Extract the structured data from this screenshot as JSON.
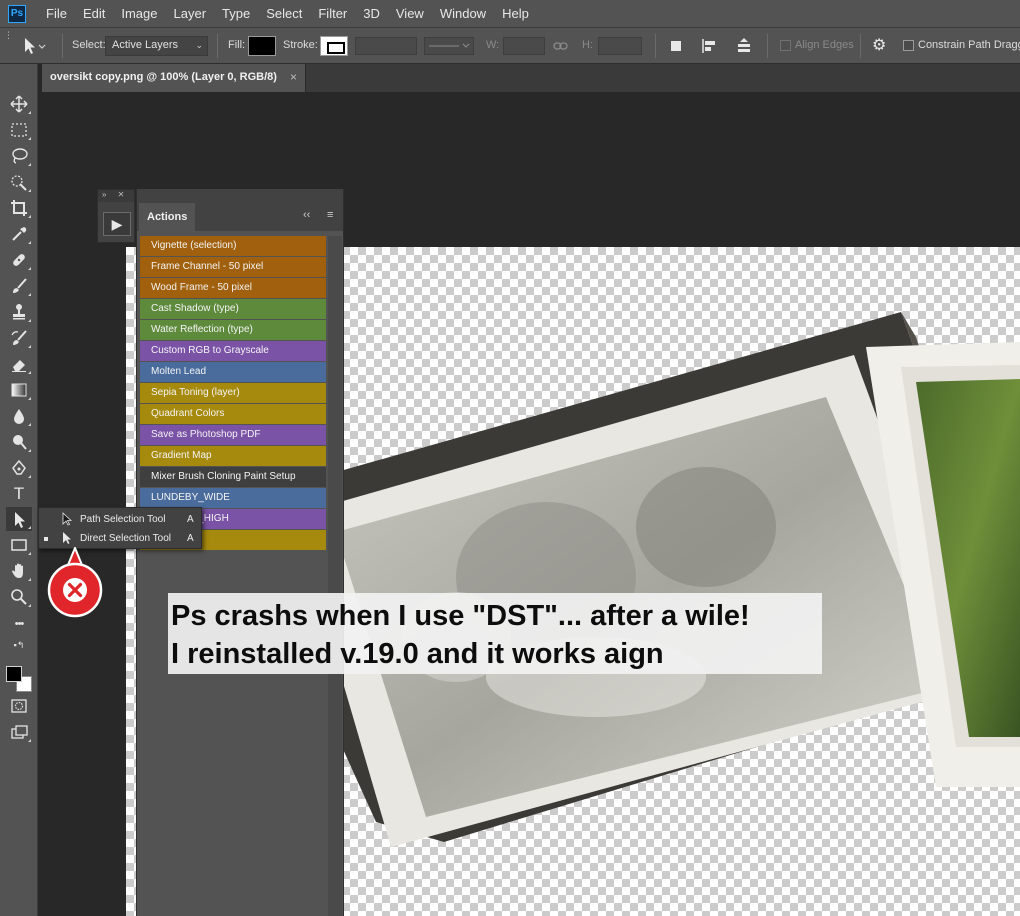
{
  "app": {
    "logo_text": "Ps",
    "menu": [
      "File",
      "Edit",
      "Image",
      "Layer",
      "Type",
      "Select",
      "Filter",
      "3D",
      "View",
      "Window",
      "Help"
    ]
  },
  "options_bar": {
    "select_label": "Select:",
    "select_value": "Active Layers",
    "fill_label": "Fill:",
    "stroke_label": "Stroke:",
    "w_label": "W:",
    "h_label": "H:",
    "align_edges_label": "Align Edges",
    "constrain_label": "Constrain Path Dragging"
  },
  "document": {
    "tab_title": "oversikt copy.png @ 100% (Layer 0, RGB/8)",
    "tab_close": "×"
  },
  "actions_panel": {
    "tab_label": "Actions",
    "collapse_glyph": "‹‹",
    "menu_glyph": "≡",
    "play_glyph": "▶",
    "items": [
      {
        "label": "Vignette (selection)",
        "color": "#a0600d"
      },
      {
        "label": "Frame Channel - 50 pixel",
        "color": "#a0600d"
      },
      {
        "label": "Wood Frame - 50 pixel",
        "color": "#a0600d"
      },
      {
        "label": "Cast Shadow (type)",
        "color": "#5e8a3c"
      },
      {
        "label": "Water Reflection (type)",
        "color": "#5e8a3c"
      },
      {
        "label": "Custom RGB to Grayscale",
        "color": "#7a52a6"
      },
      {
        "label": "Molten Lead",
        "color": "#4a6c9c"
      },
      {
        "label": "Sepia Toning (layer)",
        "color": "#a68a0e"
      },
      {
        "label": "Quadrant Colors",
        "color": "#a68a0e"
      },
      {
        "label": "Save as Photoshop PDF",
        "color": "#7a52a6"
      },
      {
        "label": "Gradient Map",
        "color": "#a68a0e"
      },
      {
        "label": "Mixer Brush Cloning Paint Setup",
        "color": "#3f3f3f"
      },
      {
        "label": "LUNDEBY_WIDE",
        "color": "#4a6c9c"
      },
      {
        "label": "LUNDEBY_HIGH",
        "color": "#7a52a6"
      },
      {
        "label": "",
        "color": "#a68a0e"
      }
    ]
  },
  "flyout": {
    "items": [
      {
        "label": "Path Selection Tool",
        "key": "A",
        "selected": false
      },
      {
        "label": "Direct Selection Tool",
        "key": "A",
        "selected": true
      }
    ]
  },
  "error_marker": {
    "glyph": "✕",
    "color": "#e0262b"
  },
  "caption": {
    "line1": "Ps crashs when I use \"DST\"... after a wile!",
    "line2": "I reinstalled v.19.0 and it works aign"
  },
  "toolbar": {
    "tools": [
      "move-tool-icon",
      "marquee-tool-icon",
      "lasso-tool-icon",
      "quick-select-tool-icon",
      "crop-tool-icon",
      "eyedropper-tool-icon",
      "healing-brush-tool-icon",
      "brush-tool-icon",
      "clone-stamp-tool-icon",
      "history-brush-tool-icon",
      "eraser-tool-icon",
      "gradient-tool-icon",
      "blur-tool-icon",
      "dodge-tool-icon",
      "pen-tool-icon",
      "type-tool-icon",
      "path-selection-tool-icon",
      "rectangle-tool-icon",
      "hand-tool-icon",
      "zoom-tool-icon",
      "more-tools-icon"
    ],
    "type_tool_glyph": "T",
    "more_glyph": "•••",
    "foreground_color": "#000000",
    "background_color": "#ffffff"
  }
}
